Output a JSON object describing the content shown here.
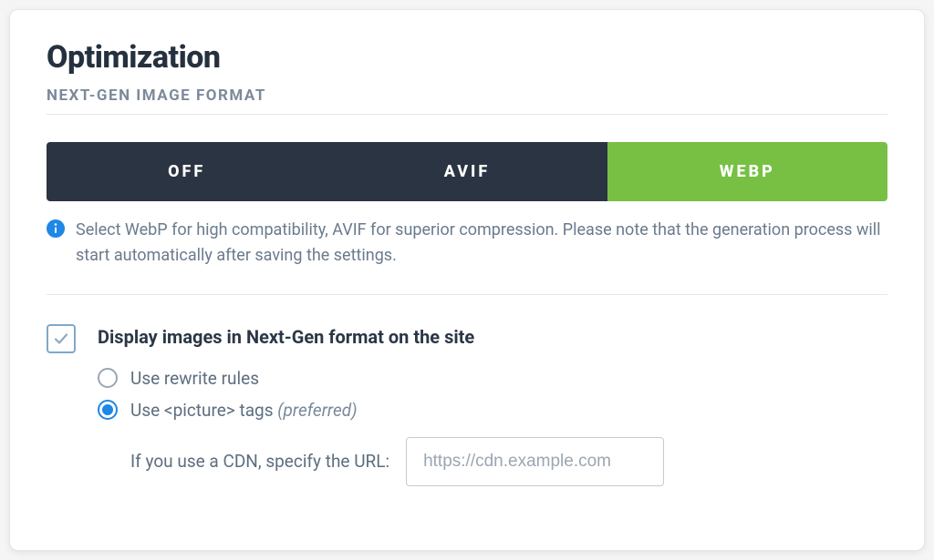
{
  "header": {
    "title": "Optimization",
    "subtitle": "NEXT-GEN IMAGE FORMAT"
  },
  "segmented": {
    "options": [
      "OFF",
      "AVIF",
      "WEBP"
    ],
    "active_index": 2
  },
  "info": {
    "text": "Select WebP for high compatibility, AVIF for superior compression. Please note that the generation process will start automatically after saving the settings."
  },
  "display_option": {
    "checked": true,
    "label": "Display images in Next-Gen format on the site",
    "radios": [
      {
        "label": "Use rewrite rules",
        "hint": "",
        "selected": false
      },
      {
        "label": "Use <picture> tags",
        "hint": "(preferred)",
        "selected": true
      }
    ],
    "cdn": {
      "label": "If you use a CDN, specify the URL:",
      "placeholder": "https://cdn.example.com",
      "value": ""
    }
  }
}
